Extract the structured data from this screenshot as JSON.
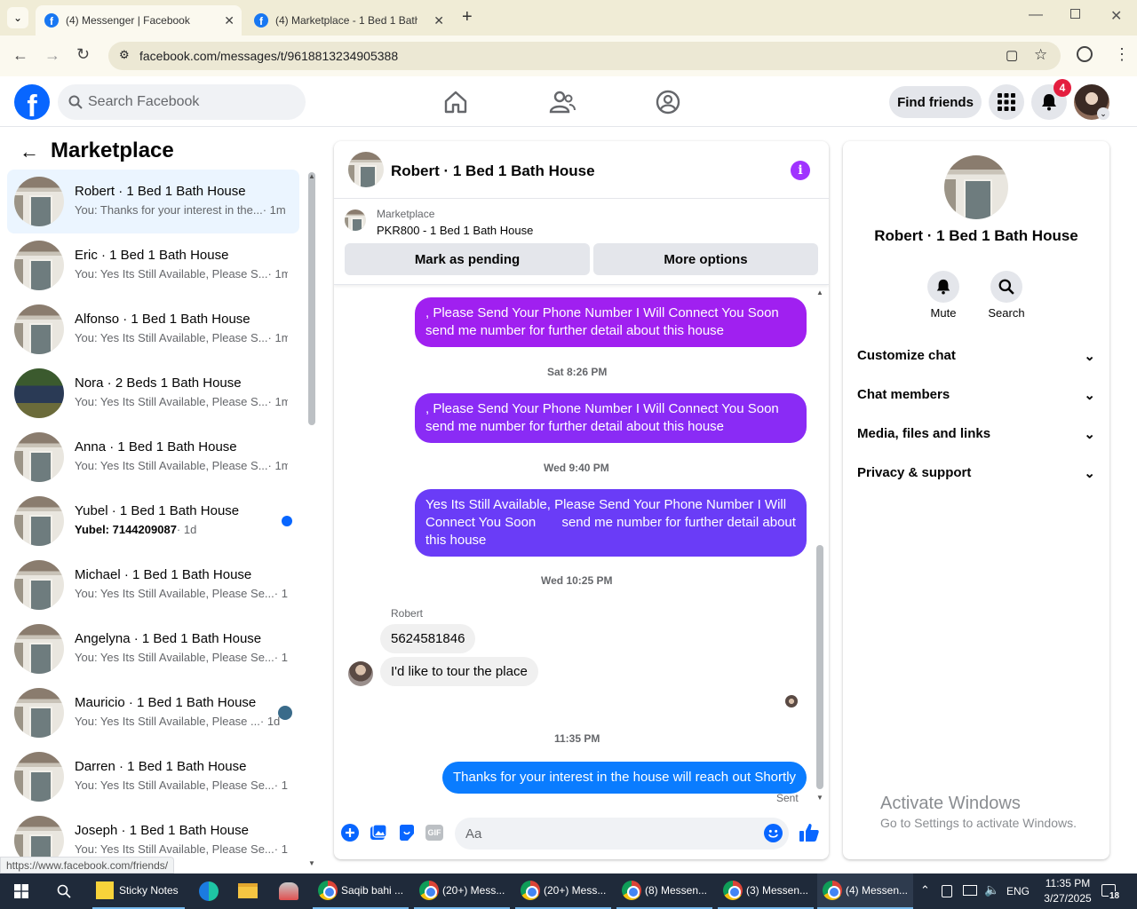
{
  "browser": {
    "tabs": [
      {
        "title": "(4) Messenger | Facebook",
        "active": true
      },
      {
        "title": "(4) Marketplace - 1 Bed 1 Bath",
        "active": false
      }
    ],
    "url": "facebook.com/messages/t/9618813234905388",
    "status_url": "https://www.facebook.com/friends/"
  },
  "header": {
    "search_placeholder": "Search Facebook",
    "find_friends_label": "Find friends",
    "notifications_count": "4"
  },
  "marketplace": {
    "title": "Marketplace",
    "conversations": [
      {
        "name": "Robert · 1 Bed 1 Bath House",
        "preview": "You: Thanks for your interest in the...",
        "time": "· 1m",
        "selected": true,
        "unread": false
      },
      {
        "name": "Eric · 1 Bed 1 Bath House",
        "preview": "You: Yes Its Still Available, Please S...",
        "time": "· 1m",
        "selected": false,
        "unread": false
      },
      {
        "name": "Alfonso · 1 Bed 1 Bath House",
        "preview": "You: Yes Its Still Available, Please S...",
        "time": "· 1m",
        "selected": false,
        "unread": false
      },
      {
        "name": "Nora · 2 Beds 1 Bath House",
        "preview": "You: Yes Its Still Available, Please S...",
        "time": "· 1m",
        "selected": false,
        "unread": false
      },
      {
        "name": "Anna · 1 Bed 1 Bath House",
        "preview": "You: Yes Its Still Available, Please S...",
        "time": "· 1m",
        "selected": false,
        "unread": false
      },
      {
        "name": "Yubel · 1 Bed 1 Bath House",
        "preview": "Yubel: 7144209087",
        "time": "· 1d",
        "selected": false,
        "unread": true
      },
      {
        "name": "Michael · 1 Bed 1 Bath House",
        "preview": "You: Yes Its Still Available, Please Se...",
        "time": "· 1d",
        "selected": false,
        "unread": false
      },
      {
        "name": "Angelyna · 1 Bed 1 Bath House",
        "preview": "You: Yes Its Still Available, Please Se...",
        "time": "· 1d",
        "selected": false,
        "unread": false
      },
      {
        "name": "Mauricio · 1 Bed 1 Bath House",
        "preview": "You: Yes Its Still Available, Please ...",
        "time": "· 1d",
        "selected": false,
        "unread": false
      },
      {
        "name": "Darren · 1 Bed 1 Bath House",
        "preview": "You: Yes Its Still Available, Please Se...",
        "time": "· 1d",
        "selected": false,
        "unread": false
      },
      {
        "name": "Joseph · 1 Bed 1 Bath House",
        "preview": "You: Yes Its Still Available, Please Se...",
        "time": "· 1d",
        "selected": false,
        "unread": false
      }
    ]
  },
  "chat": {
    "title": "Robert · 1 Bed 1 Bath House",
    "listing_source": "Marketplace",
    "listing_title": "PKR800 - 1 Bed 1 Bath House",
    "mark_pending_label": "Mark as pending",
    "more_options_label": "More options",
    "messages": {
      "m1": ", Please Send Your Phone Number I Will Connect You Soon send me number for further detail about this house",
      "t1": "Sat 8:26 PM",
      "m2": ", Please Send Your Phone Number I Will Connect You Soon send me number for further detail about this house",
      "t2": "Wed 9:40 PM",
      "m3": "Yes Its Still Available, Please Send Your Phone Number I Will Connect You Soon       send me number for further detail about this house",
      "t3": "Wed 10:25 PM",
      "sender": "Robert",
      "in1": "5624581846",
      "in2": "I'd like to tour the place",
      "t4": "11:35 PM",
      "m4": "Thanks for your interest in the house will reach out Shortly",
      "status": "Sent"
    },
    "composer_placeholder": "Aa"
  },
  "info_panel": {
    "name": "Robert · 1 Bed 1 Bath House",
    "mute_label": "Mute",
    "search_label": "Search",
    "sections": [
      "Customize chat",
      "Chat members",
      "Media, files and links",
      "Privacy & support"
    ]
  },
  "watermark": {
    "title": "Activate Windows",
    "subtitle": "Go to Settings to activate Windows."
  },
  "taskbar": {
    "apps": [
      "Sticky Notes",
      "Saqib bahi ...",
      "(20+) Mess...",
      "(20+) Mess...",
      "(8) Messen...",
      "(3) Messen...",
      "(4) Messen..."
    ],
    "language": "ENG",
    "time": "11:35 PM",
    "date": "3/27/2025",
    "notifications": "18"
  }
}
